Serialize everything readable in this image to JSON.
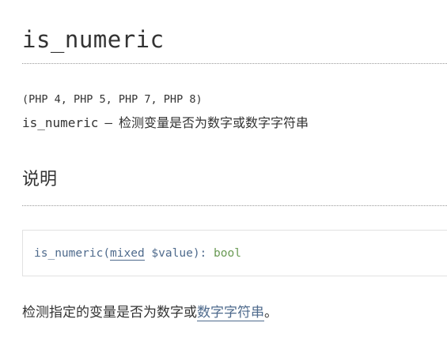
{
  "refname": "is_numeric",
  "version_info": "(PHP 4, PHP 5, PHP 7, PHP 8)",
  "refpurpose": {
    "name": "is_numeric",
    "dash": "—",
    "description": "检测变量是否为数字或数字字符串"
  },
  "section": {
    "title": "说明"
  },
  "synopsis": {
    "function_name": "is_numeric",
    "open_paren": "(",
    "param_type": "mixed",
    "param_name": " $value",
    "close_paren": ")",
    "colon": ": ",
    "return_type": "bool"
  },
  "description": {
    "text_before": "检测指定的变量是否为数字或",
    "link_text": "数字字符串",
    "text_after": "。"
  },
  "colors": {
    "link": "#4e6a8c",
    "return_type": "#6a9a54",
    "text": "#333333"
  }
}
